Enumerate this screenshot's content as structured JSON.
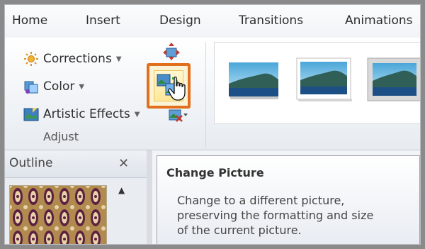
{
  "tabs": [
    "Home",
    "Insert",
    "Design",
    "Transitions",
    "Animations"
  ],
  "ribbon": {
    "corrections_label": "Corrections",
    "color_label": "Color",
    "artistic_effects_label": "Artistic Effects",
    "dropdown_glyph": "▼",
    "group_label": "Adjust"
  },
  "outline_pane": {
    "tab_label": "Outline",
    "close_glyph": "✕",
    "scroll_up_glyph": "▲"
  },
  "tooltip": {
    "title": "Change Picture",
    "body": "Change to a different picture,\npreserving the formatting and size\nof the current picture."
  },
  "colors": {
    "highlight_border": "#e06f1e",
    "tooltip_border": "#9aa3ae"
  }
}
